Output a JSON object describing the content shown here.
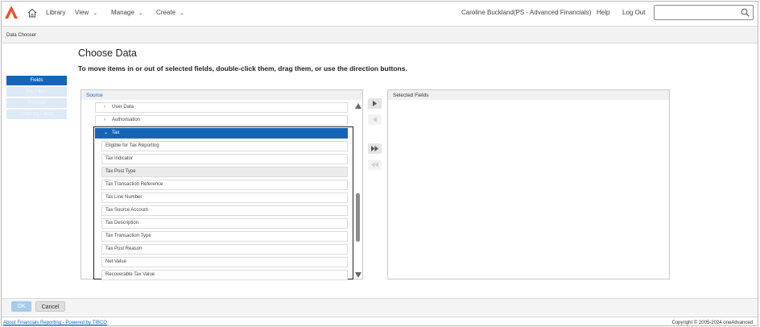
{
  "nav": {
    "items": [
      {
        "label": "Library",
        "dropdown": false
      },
      {
        "label": "View",
        "dropdown": true
      },
      {
        "label": "Manage",
        "dropdown": true
      },
      {
        "label": "Create",
        "dropdown": true
      }
    ],
    "user": "Caroline Buckland(PS - Advanced Financials)",
    "help": "Help",
    "logout": "Log Out",
    "search_value": "",
    "brand_color": "#f04e23"
  },
  "subheader": {
    "title": "Data Chooser"
  },
  "page": {
    "title": "Choose Data",
    "instructions": "To move items in or out of selected fields, double-click them, drag them, or use the direction buttons."
  },
  "sidetabs": [
    {
      "label": "Fields",
      "active": true
    },
    {
      "label": "Pre Filters",
      "active": false
    },
    {
      "label": "Prompts",
      "active": false
    },
    {
      "label": "Order by Fields",
      "active": false
    }
  ],
  "source": {
    "title": "Source",
    "groups": [
      {
        "label": "User Data",
        "expanded": false,
        "selected": false
      },
      {
        "label": "Authorisation",
        "expanded": false,
        "selected": false
      },
      {
        "label": "Tax",
        "expanded": true,
        "selected": true
      }
    ],
    "fields": [
      {
        "label": "Eligible for Tax Reporting",
        "shaded": false
      },
      {
        "label": "Tax Indicator",
        "shaded": false
      },
      {
        "label": "Tax Post Type",
        "shaded": true
      },
      {
        "label": "Tax Transaction Reference",
        "shaded": false
      },
      {
        "label": "Tax Line Number",
        "shaded": false
      },
      {
        "label": "Tax Source Account",
        "shaded": false
      },
      {
        "label": "Tax Description",
        "shaded": false
      },
      {
        "label": "Tax Transaction Type",
        "shaded": false
      },
      {
        "label": "Tax Post Reason",
        "shaded": false
      },
      {
        "label": "Net Value",
        "shaded": false
      },
      {
        "label": "Recoverable Tax Value",
        "shaded": false
      }
    ]
  },
  "direction_buttons": [
    {
      "icon": "move-right-icon",
      "enabled": true
    },
    {
      "icon": "move-left-icon",
      "enabled": false
    },
    {
      "icon": "move-all-right-icon",
      "enabled": true
    },
    {
      "icon": "move-all-left-icon",
      "enabled": false
    }
  ],
  "selected": {
    "title": "Selected Fields",
    "items": []
  },
  "footer": {
    "ok_label": "OK",
    "cancel_label": "Cancel",
    "about_link": "About Financials Reporting - Powered by TIBCO",
    "copyright": "Copyright © 2005-2024 oneAdvanced"
  },
  "colors": {
    "accent": "#1565b7",
    "tab_inactive": "#dce9f6",
    "ok_disabled": "#a7cbec"
  }
}
